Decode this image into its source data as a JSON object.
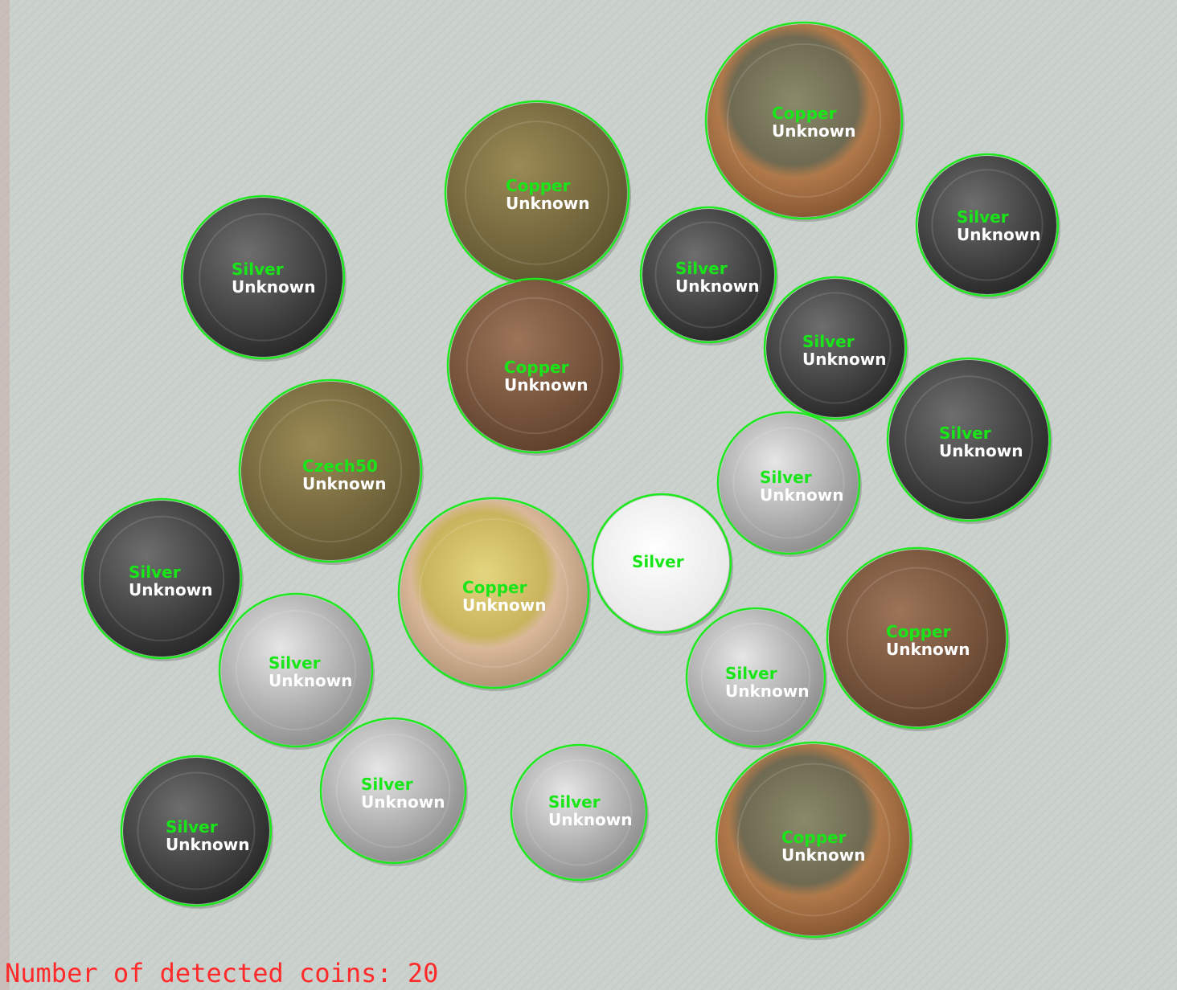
{
  "summary": {
    "count_label": "Number of detected coins:",
    "count_value": "20"
  },
  "colors": {
    "circle": "#1ee81e",
    "material_text": "#19e619",
    "type_text": "#ffffff",
    "count_text": "#ff2a2a"
  },
  "coins": [
    {
      "material": "Copper",
      "type": "Unknown",
      "face": "bimetal-gold-edge"
    },
    {
      "material": "Copper",
      "type": "Unknown",
      "face": "brass"
    },
    {
      "material": "Silver",
      "type": "Unknown",
      "face": "dark-steel"
    },
    {
      "material": "Silver",
      "type": "Unknown",
      "face": "dark-steel"
    },
    {
      "material": "Silver",
      "type": "Unknown",
      "face": "dark-steel"
    },
    {
      "material": "Copper",
      "type": "Unknown",
      "face": "bronze"
    },
    {
      "material": "Silver",
      "type": "Unknown",
      "face": "dark-steel"
    },
    {
      "material": "Czech50",
      "type": "Unknown",
      "face": "brass"
    },
    {
      "material": "Silver",
      "type": "Unknown",
      "face": "dark-steel"
    },
    {
      "material": "Silver",
      "type": "Unknown",
      "face": "light-silver"
    },
    {
      "material": "Silver",
      "type": "Unknown",
      "face": "dark-steel"
    },
    {
      "material": "Copper",
      "type": "Unknown",
      "face": "bimetal-silver-edge"
    },
    {
      "material": "Silver",
      "type": "",
      "face": "white"
    },
    {
      "material": "Copper",
      "type": "Unknown",
      "face": "bronze"
    },
    {
      "material": "Silver",
      "type": "Unknown",
      "face": "light-silver"
    },
    {
      "material": "Silver",
      "type": "Unknown",
      "face": "light-silver"
    },
    {
      "material": "Silver",
      "type": "Unknown",
      "face": "dark-steel"
    },
    {
      "material": "Silver",
      "type": "Unknown",
      "face": "light-silver"
    },
    {
      "material": "Silver",
      "type": "Unknown",
      "face": "light-silver"
    },
    {
      "material": "Copper",
      "type": "Unknown",
      "face": "bimetal-gold-edge"
    }
  ]
}
